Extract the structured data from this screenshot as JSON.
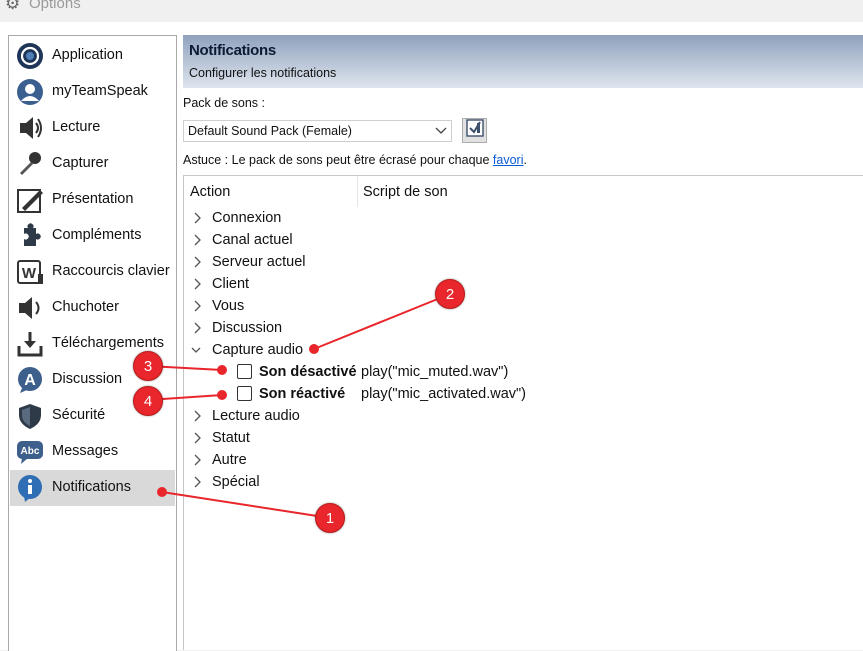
{
  "window": {
    "title": "Options"
  },
  "sidebar": {
    "items": [
      {
        "label": "Application",
        "icon": "application-icon"
      },
      {
        "label": "myTeamSpeak",
        "icon": "user-icon"
      },
      {
        "label": "Lecture",
        "icon": "speaker-icon"
      },
      {
        "label": "Capturer",
        "icon": "microphone-icon"
      },
      {
        "label": "Présentation",
        "icon": "pen-icon"
      },
      {
        "label": "Compléments",
        "icon": "puzzle-icon"
      },
      {
        "label": "Raccourcis clavier",
        "icon": "keyboard-icon"
      },
      {
        "label": "Chuchoter",
        "icon": "whisper-icon"
      },
      {
        "label": "Téléchargements",
        "icon": "download-icon"
      },
      {
        "label": "Discussion",
        "icon": "chat-icon"
      },
      {
        "label": "Sécurité",
        "icon": "shield-icon"
      },
      {
        "label": "Messages",
        "icon": "messages-icon"
      },
      {
        "label": "Notifications",
        "icon": "info-icon",
        "selected": true
      }
    ]
  },
  "banner": {
    "title": "Notifications",
    "subtitle": "Configurer les notifications"
  },
  "sound_pack": {
    "label": "Pack de sons :",
    "selected": "Default Sound Pack (Female)",
    "hint_prefix": "Astuce : Le pack de sons peut être écrasé pour chaque ",
    "hint_link": "favori",
    "hint_suffix": "."
  },
  "tree": {
    "columns": [
      "Action",
      "Script de son"
    ],
    "rows": [
      {
        "label": "Connexion",
        "expanded": false
      },
      {
        "label": "Canal actuel",
        "expanded": false
      },
      {
        "label": "Serveur actuel",
        "expanded": false
      },
      {
        "label": "Client",
        "expanded": false
      },
      {
        "label": "Vous",
        "expanded": false
      },
      {
        "label": "Discussion",
        "expanded": false
      },
      {
        "label": "Capture audio",
        "expanded": true
      },
      {
        "label": "Son désactivé",
        "script": "play(\"mic_muted.wav\")",
        "checked": false,
        "child": true
      },
      {
        "label": "Son réactivé",
        "script": "play(\"mic_activated.wav\")",
        "checked": false,
        "child": true
      },
      {
        "label": "Lecture audio",
        "expanded": false
      },
      {
        "label": "Statut",
        "expanded": false
      },
      {
        "label": "Autre",
        "expanded": false
      },
      {
        "label": "Spécial",
        "expanded": false
      }
    ]
  },
  "annotations": {
    "color": "#e8262b",
    "markers": [
      "1",
      "2",
      "3",
      "4"
    ]
  }
}
